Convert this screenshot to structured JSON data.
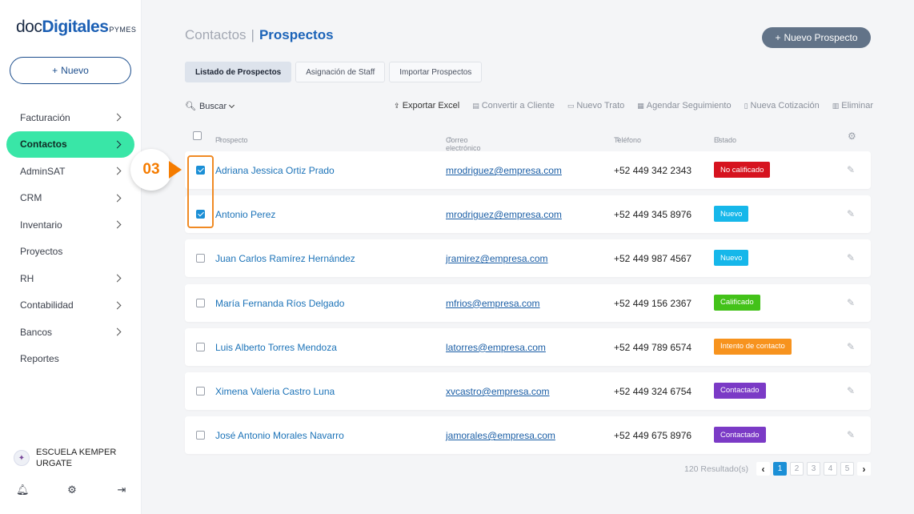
{
  "brand": {
    "prefix": "doc",
    "name": "Digitales",
    "suffix": "PYMES"
  },
  "sidebar": {
    "new_label": "Nuevo",
    "items": [
      {
        "label": "Facturación",
        "has_children": true,
        "active": false
      },
      {
        "label": "Contactos",
        "has_children": true,
        "active": true
      },
      {
        "label": "AdminSAT",
        "has_children": true,
        "active": false
      },
      {
        "label": "CRM",
        "has_children": true,
        "active": false
      },
      {
        "label": "Inventario",
        "has_children": true,
        "active": false
      },
      {
        "label": "Proyectos",
        "has_children": false,
        "active": false
      },
      {
        "label": "RH",
        "has_children": true,
        "active": false
      },
      {
        "label": "Contabilidad",
        "has_children": true,
        "active": false
      },
      {
        "label": "Bancos",
        "has_children": true,
        "active": false
      },
      {
        "label": "Reportes",
        "has_children": false,
        "active": false
      }
    ],
    "account_name": "ESCUELA KEMPER URGATE"
  },
  "header": {
    "breadcrumb_parent": "Contactos",
    "breadcrumb_sep": "|",
    "breadcrumb_current": "Prospectos",
    "new_prospect_label": "Nuevo Prospecto"
  },
  "tabs": [
    {
      "label": "Listado de Prospectos",
      "active": true
    },
    {
      "label": "Asignación de Staff",
      "active": false
    },
    {
      "label": "Importar Prospectos",
      "active": false
    }
  ],
  "toolbar": {
    "search_label": "Buscar",
    "actions": [
      {
        "label": "Exportar Excel",
        "icon": "⇪",
        "icon_name": "export-icon"
      },
      {
        "label": "Convertir a Cliente",
        "icon": "▤",
        "icon_name": "convert-icon"
      },
      {
        "label": "Nuevo Trato",
        "icon": "▭",
        "icon_name": "deal-icon"
      },
      {
        "label": "Agendar Seguimiento",
        "icon": "▦",
        "icon_name": "calendar-icon"
      },
      {
        "label": "Nueva Cotización",
        "icon": "▯",
        "icon_name": "quote-icon"
      },
      {
        "label": "Eliminar",
        "icon": "▥",
        "icon_name": "trash-icon"
      }
    ]
  },
  "table": {
    "columns": {
      "prospect": "Prospecto",
      "email": "Correo electrónico",
      "phone": "Teléfono",
      "status": "Estado"
    },
    "rows": [
      {
        "name": "Adriana Jessica Ortiz Prado",
        "email": "mrodriguez@empresa.com",
        "phone": "+52 449 342 2343",
        "status": "No calificado",
        "status_color": "#d6131f",
        "checked": true
      },
      {
        "name": "Antonio Perez",
        "email": "mrodriguez@empresa.com",
        "phone": "+52 449 345 8976",
        "status": "Nuevo",
        "status_color": "#16b7ea",
        "checked": true
      },
      {
        "name": "Juan Carlos Ramírez Hernández",
        "email": "jramirez@empresa.com",
        "phone": "+52 449 987 4567",
        "status": "Nuevo",
        "status_color": "#16b7ea",
        "checked": false
      },
      {
        "name": "María Fernanda Ríos Delgado",
        "email": "mfrios@empresa.com",
        "phone": "+52 449 156 2367",
        "status": "Calificado",
        "status_color": "#43c219",
        "checked": false
      },
      {
        "name": "Luis Alberto Torres Mendoza",
        "email": "latorres@empresa.com",
        "phone": "+52 449 789 6574",
        "status": "Intento de contacto",
        "status_color": "#f7931e",
        "checked": false
      },
      {
        "name": "Ximena Valeria Castro Luna",
        "email": "xvcastro@empresa.com",
        "phone": "+52 449 324 6754",
        "status": "Contactado",
        "status_color": "#7b3ac6",
        "checked": false
      },
      {
        "name": "José Antonio Morales Navarro",
        "email": "jamorales@empresa.com",
        "phone": "+52 449 675 8976",
        "status": "Contactado",
        "status_color": "#7b3ac6",
        "checked": false
      }
    ]
  },
  "pagination": {
    "results": "120 Resultado(s)",
    "pages": [
      "1",
      "2",
      "3",
      "4",
      "5"
    ],
    "current": "1"
  },
  "callout": {
    "label": "03",
    "color": "#f57c00"
  }
}
